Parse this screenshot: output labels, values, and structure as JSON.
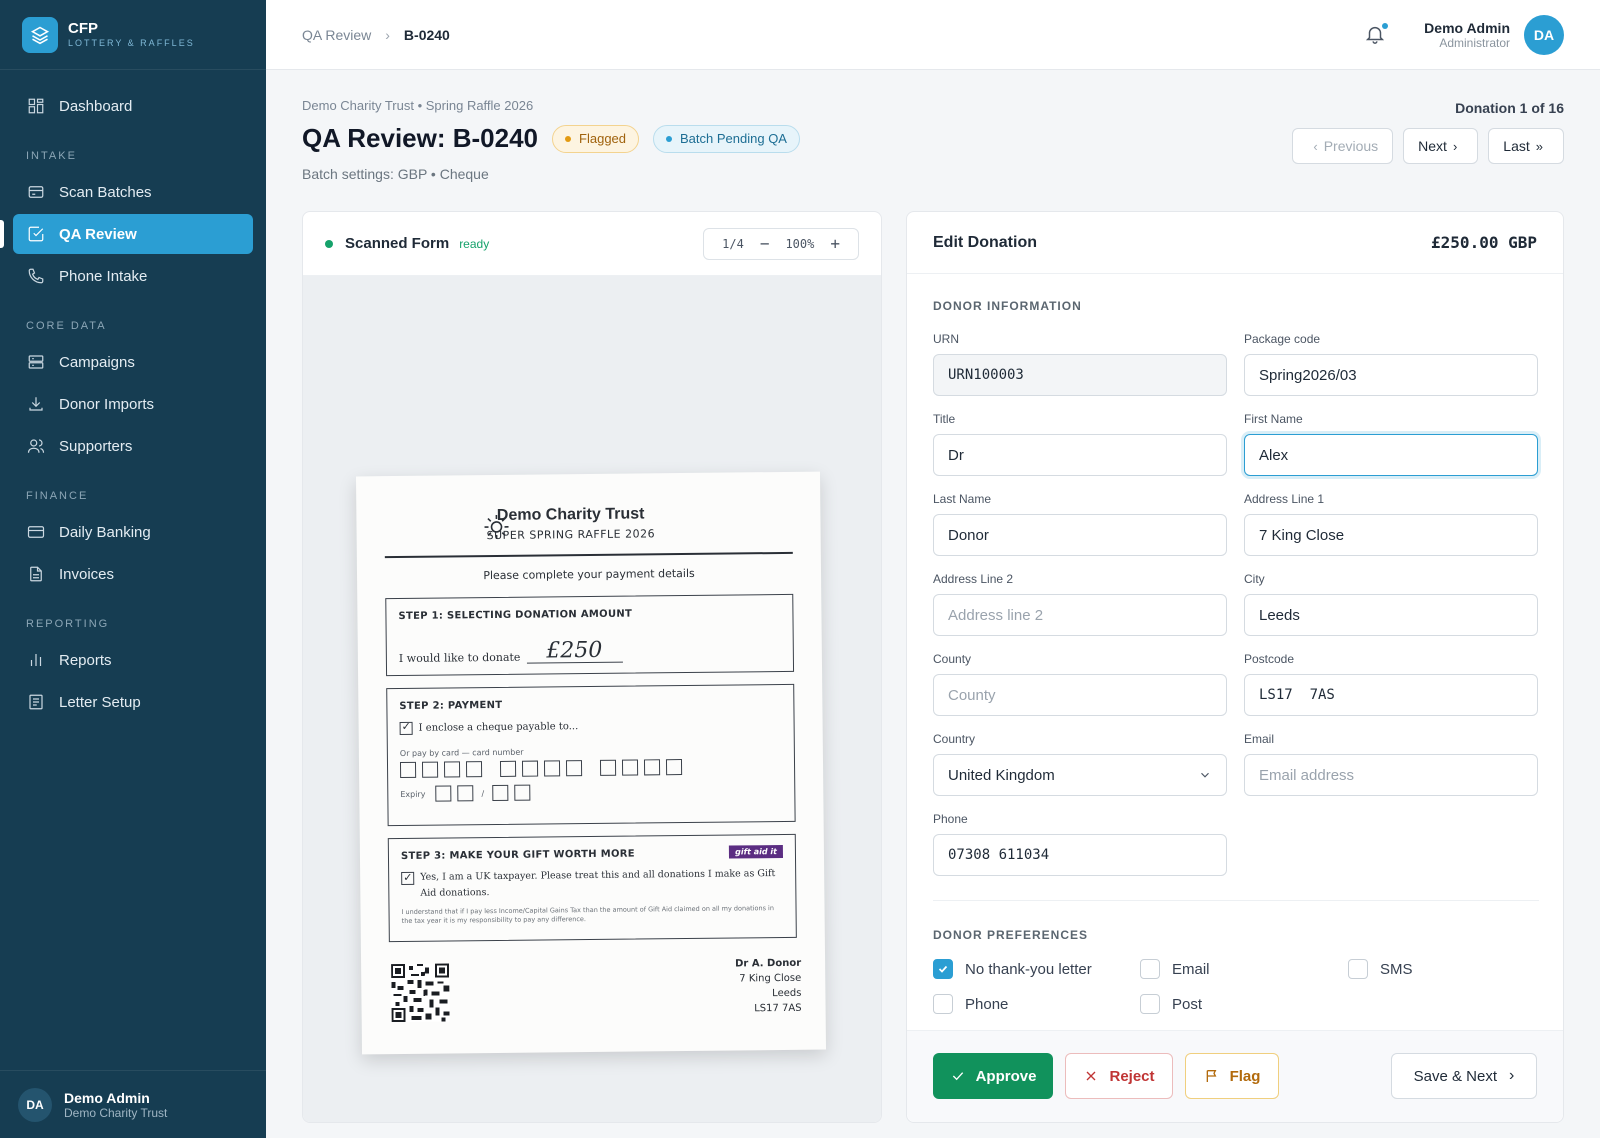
{
  "brand": {
    "name": "CFP",
    "subtitle": "LOTTERY & RAFFLES"
  },
  "sidebar": {
    "items_top": [
      {
        "label": "Dashboard",
        "icon": "grid-icon"
      }
    ],
    "sections": [
      {
        "title": "INTAKE",
        "items": [
          {
            "label": "Scan Batches",
            "icon": "scanner-icon"
          },
          {
            "label": "QA Review",
            "icon": "check-square-icon",
            "active": true
          },
          {
            "label": "Phone Intake",
            "icon": "phone-icon"
          }
        ]
      },
      {
        "title": "CORE DATA",
        "items": [
          {
            "label": "Campaigns",
            "icon": "server-icon"
          },
          {
            "label": "Donor Imports",
            "icon": "download-icon"
          },
          {
            "label": "Supporters",
            "icon": "users-icon"
          }
        ]
      },
      {
        "title": "FINANCE",
        "items": [
          {
            "label": "Daily Banking",
            "icon": "credit-card-icon"
          },
          {
            "label": "Invoices",
            "icon": "document-icon"
          }
        ]
      },
      {
        "title": "REPORTING",
        "items": [
          {
            "label": "Reports",
            "icon": "bar-chart-icon"
          },
          {
            "label": "Letter Setup",
            "icon": "letter-icon"
          }
        ]
      }
    ],
    "user": {
      "initials": "DA",
      "name": "Demo Admin",
      "org": "Demo Charity Trust"
    }
  },
  "topbar": {
    "breadcrumb": [
      "QA Review",
      "B-0240"
    ],
    "user": {
      "name": "Demo Admin",
      "role": "Administrator",
      "initials": "DA"
    }
  },
  "header": {
    "context": "Demo Charity Trust • Spring Raffle 2026",
    "title": "QA Review: B-0240",
    "badges": [
      "Flagged",
      "Batch Pending QA"
    ],
    "batch_settings": "Batch settings: GBP • Cheque",
    "donation_count": "Donation 1 of 16",
    "pager": {
      "previous": "Previous",
      "next": "Next",
      "last": "Last"
    }
  },
  "scan": {
    "title": "Scanned Form",
    "status": "ready",
    "page": "1/4",
    "zoom": "100%",
    "form": {
      "org": "Demo Charity Trust",
      "campaign": "SUPER SPRING RAFFLE 2026",
      "instructions": "Please complete your payment details",
      "step1_title": "STEP 1: SELECTING DONATION AMOUNT",
      "step1_text": "I would like to donate",
      "step1_amount": "£250",
      "step2_title": "STEP 2: PAYMENT",
      "step2_cheque": "I enclose a cheque payable to...",
      "step2_card": "Or pay by card — card number",
      "step2_expiry": "Expiry",
      "step3_title": "STEP 3: MAKE YOUR GIFT WORTH MORE",
      "step3_badge": "gift aid it",
      "step3_text": "Yes, I am a UK taxpayer. Please treat this and all donations I make as Gift Aid donations.",
      "step3_fine": "I understand that if I pay less Income/Capital Gains Tax than the amount of Gift Aid claimed on all my donations in the tax year it is my responsibility to pay any difference.",
      "addr_name": "Dr A. Donor",
      "addr_line1": "7 King Close",
      "addr_city": "Leeds",
      "addr_postcode": "LS17  7AS"
    }
  },
  "edit": {
    "title": "Edit Donation",
    "amount": "£250.00 GBP",
    "donor_section": "DONOR INFORMATION",
    "fields": {
      "urn": {
        "label": "URN",
        "value": "URN100003"
      },
      "package": {
        "label": "Package code",
        "value": "Spring2026/03"
      },
      "title": {
        "label": "Title",
        "value": "Dr"
      },
      "first_name": {
        "label": "First Name",
        "value": "Alex"
      },
      "last_name": {
        "label": "Last Name",
        "value": "Donor"
      },
      "address1": {
        "label": "Address Line 1",
        "value": "7 King Close"
      },
      "address2": {
        "label": "Address Line 2",
        "placeholder": "Address line 2"
      },
      "city": {
        "label": "City",
        "value": "Leeds"
      },
      "county": {
        "label": "County",
        "placeholder": "County"
      },
      "postcode": {
        "label": "Postcode",
        "value": "LS17  7AS"
      },
      "country": {
        "label": "Country",
        "value": "United Kingdom"
      },
      "email": {
        "label": "Email",
        "placeholder": "Email address"
      },
      "phone": {
        "label": "Phone",
        "value": "07308 611034"
      }
    },
    "prefs_section": "DONOR PREFERENCES",
    "prefs": {
      "no_thanks": {
        "label": "No thank-you letter",
        "checked": true
      },
      "email": {
        "label": "Email",
        "checked": false
      },
      "sms": {
        "label": "SMS",
        "checked": false
      },
      "phone": {
        "label": "Phone",
        "checked": false
      },
      "post": {
        "label": "Post",
        "checked": false
      }
    },
    "actions": {
      "approve": "Approve",
      "reject": "Reject",
      "flag": "Flag",
      "save_next": "Save & Next"
    }
  },
  "colors": {
    "sidebar": "#163d52",
    "accent": "#2b9ed3",
    "approve": "#11925c",
    "reject": "#c03434",
    "flag": "#b26a0c"
  }
}
